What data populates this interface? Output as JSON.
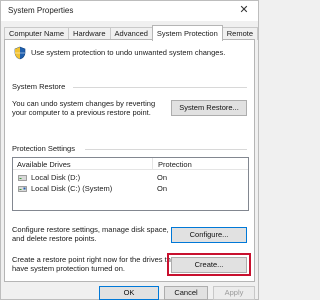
{
  "window": {
    "title": "System Properties",
    "close_glyph": "✕"
  },
  "tabs": [
    {
      "label": "Computer Name"
    },
    {
      "label": "Hardware"
    },
    {
      "label": "Advanced"
    },
    {
      "label": "System Protection"
    },
    {
      "label": "Remote"
    }
  ],
  "intro": {
    "icon": "shield-icon",
    "text": "Use system protection to undo unwanted system changes."
  },
  "system_restore": {
    "heading": "System Restore",
    "description_line1": "You can undo system changes by reverting",
    "description_line2": "your computer to a previous restore point.",
    "button_label": "System Restore..."
  },
  "protection_settings": {
    "heading": "Protection Settings",
    "columns": [
      "Available Drives",
      "Protection"
    ],
    "drives": [
      {
        "name": "Local Disk (D:)",
        "protection": "On",
        "icon": "disk-icon"
      },
      {
        "name": "Local Disk (C:) (System)",
        "protection": "On",
        "icon": "disk-icon"
      }
    ],
    "configure_text_line1": "Configure restore settings, manage disk space,",
    "configure_text_line2": "and delete restore points.",
    "configure_button": "Configure...",
    "create_text_line1": "Create a restore point right now for the drives that",
    "create_text_line2": "have system protection turned on.",
    "create_button": "Create..."
  },
  "footer": {
    "ok": "OK",
    "cancel": "Cancel",
    "apply": "Apply"
  },
  "colors": {
    "highlight": "#c8102e",
    "accent": "#0078d7"
  }
}
